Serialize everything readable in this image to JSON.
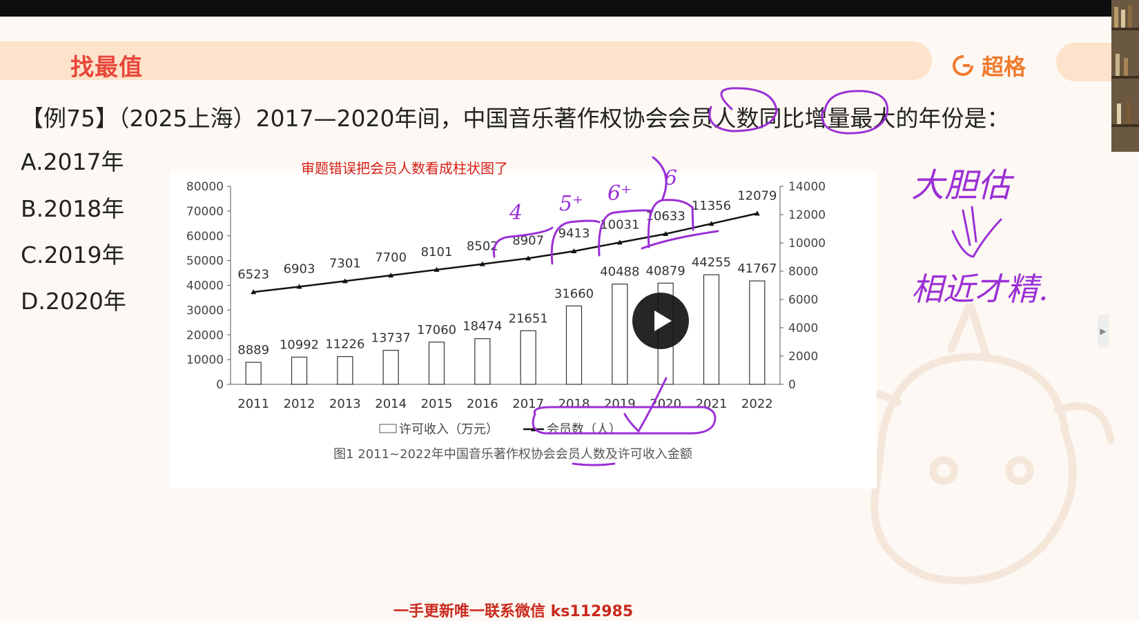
{
  "header": {
    "title": "找最值",
    "brand": "超格"
  },
  "question": {
    "text": "【例75】（2025上海）2017—2020年间，中国音乐著作权协会会员人数同比增量最大的年份是："
  },
  "options": [
    {
      "label": "A.2017年"
    },
    {
      "label": "B.2018年"
    },
    {
      "label": "C.2019年"
    },
    {
      "label": "D.2020年"
    }
  ],
  "annotation_note": "审题错误把会员人数看成柱状图了",
  "handwriting": {
    "marks": [
      "4",
      "5⁺",
      "6⁺",
      "6"
    ],
    "note_line1": "大胆估",
    "note_line2": "相近才精."
  },
  "chart_data": {
    "type": "bar",
    "categories": [
      "2011",
      "2012",
      "2013",
      "2014",
      "2015",
      "2016",
      "2017",
      "2018",
      "2019",
      "2020",
      "2021",
      "2022"
    ],
    "series": [
      {
        "name": "许可收入（万元）",
        "type": "bar",
        "axis": "left",
        "values": [
          8889,
          10992,
          11226,
          13737,
          17060,
          18474,
          21651,
          31660,
          40488,
          40879,
          44255,
          41767
        ]
      },
      {
        "name": "会员数（人）",
        "type": "line",
        "axis": "right",
        "values": [
          6523,
          6903,
          7301,
          7700,
          8101,
          8502,
          8907,
          9413,
          10031,
          10633,
          11356,
          12079
        ]
      }
    ],
    "left_axis": {
      "ylim": [
        0,
        80000
      ],
      "ticks": [
        0,
        10000,
        20000,
        30000,
        40000,
        50000,
        60000,
        70000,
        80000
      ]
    },
    "right_axis": {
      "ylim": [
        0,
        14000
      ],
      "ticks": [
        0,
        2000,
        4000,
        6000,
        8000,
        10000,
        12000,
        14000
      ]
    },
    "bar_labels": [
      "8889",
      "10992",
      "11226",
      "13737",
      "17060",
      "18474",
      "21651",
      "31660",
      "40488",
      "40879",
      "44255",
      "41767"
    ],
    "line_labels": [
      "6523",
      "6903",
      "7301",
      "7700",
      "8101",
      "8502",
      "8907",
      "9413",
      "10031",
      "10633",
      "11356",
      "12079"
    ],
    "legend": {
      "bar": "许可收入（万元）",
      "line": "会员数（人）",
      "placement": "bottom"
    },
    "caption": "图1  2011~2022年中国音乐著作权协会会员人数及许可收入金额",
    "colors": {
      "bar_fill": "#ffffff",
      "bar_stroke": "#333333",
      "line": "#111111"
    }
  },
  "colors": {
    "header_text": "#e8473a",
    "brand": "#f07a2c",
    "header_band": "#fde3cb",
    "annotation": "#d6201a",
    "ink": "#9b2fd6"
  },
  "watermark": "一手更新唯一联系微信 ks112985"
}
